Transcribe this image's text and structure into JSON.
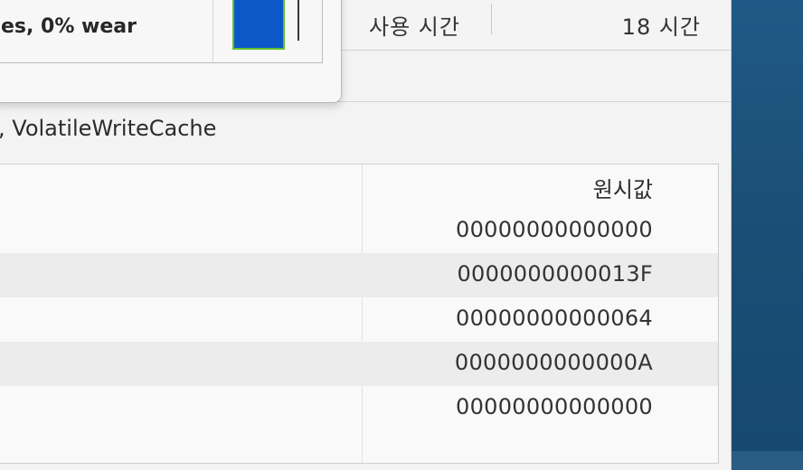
{
  "summary": {
    "usage_label": "사용 시간",
    "usage_value": "18 시간"
  },
  "features": {
    "text": ", VolatileWriteCache"
  },
  "smart_table": {
    "header_raw": "원시값",
    "rows": [
      {
        "raw": "00000000000000"
      },
      {
        "raw": "0000000000013F"
      },
      {
        "raw": "00000000000064"
      },
      {
        "raw": "0000000000000A"
      },
      {
        "raw": "00000000000000"
      }
    ]
  },
  "popup": {
    "wear_text": "es, 0% wear",
    "colors": {
      "health_fill": "#0c58c9",
      "health_border": "#62bf2d"
    }
  },
  "colors": {
    "desktop": "#1f5a86"
  }
}
